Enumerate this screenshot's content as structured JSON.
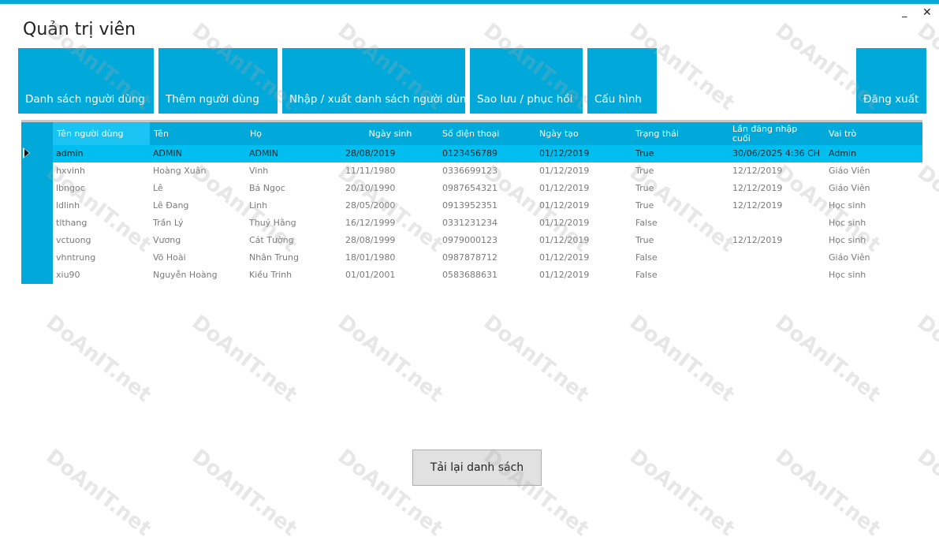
{
  "window": {
    "title": "Quản trị viên",
    "minimize_glyph": "_",
    "close_glyph": "✕"
  },
  "tiles": [
    {
      "label": "Danh sách người dùng"
    },
    {
      "label": "Thêm người dùng"
    },
    {
      "label": "Nhập / xuất danh sách người dùng"
    },
    {
      "label": "Sao lưu / phục hồi"
    },
    {
      "label": "Cấu hình"
    },
    {
      "label": "Đăng xuất"
    }
  ],
  "table": {
    "headers": [
      "Tên người dùng",
      "Tên",
      "Họ",
      "Ngày sinh",
      "Số điện thoại",
      "Ngày tạo",
      "Trạng thái",
      "Lần đăng nhập cuối",
      "Vai trò"
    ],
    "selected_row": 0,
    "rows": [
      [
        "admin",
        "ADMIN",
        "ADMIN",
        "28/08/2019",
        "0123456789",
        "01/12/2019",
        "True",
        "30/06/2025 4:36 CH",
        "Admin"
      ],
      [
        "hxvinh",
        "Hoàng Xuân",
        "Vinh",
        "11/11/1980",
        "0336699123",
        "01/12/2019",
        "True",
        "12/12/2019",
        "Giáo Viên"
      ],
      [
        "lbngoc",
        "Lê",
        "Bá Ngọc",
        "20/10/1990",
        "0987654321",
        "01/12/2019",
        "True",
        "12/12/2019",
        "Giáo Viên"
      ],
      [
        "ldlinh",
        "Lê Đang",
        "Linh",
        "28/05/2000",
        "0913952351",
        "01/12/2019",
        "True",
        "12/12/2019",
        "Học sinh"
      ],
      [
        "tlthang",
        "Trần Lý",
        "Thuý Hằng",
        "16/12/1999",
        "0331231234",
        "01/12/2019",
        "False",
        "",
        "Học sinh"
      ],
      [
        "vctuong",
        "Vương",
        "Cát Tường",
        "28/08/1999",
        "0979000123",
        "01/12/2019",
        "True",
        "12/12/2019",
        "Học sinh"
      ],
      [
        "vhntrung",
        "Võ Hoài",
        "Nhân Trung",
        "18/01/1980",
        "0987878712",
        "01/12/2019",
        "False",
        "",
        "Giáo Viên"
      ],
      [
        "xiu90",
        "Nguyễn Hoàng",
        "Kiều Trinh",
        "01/01/2001",
        "0583688631",
        "01/12/2019",
        "False",
        "",
        "Học sinh"
      ]
    ]
  },
  "reload_button": {
    "label": "Tải lại danh sách"
  },
  "watermark": {
    "text": "DoAnIT.net"
  },
  "colors": {
    "accent": "#00a9d9",
    "selected_row": "#00bff0",
    "top_bar": "#0aa8d8"
  }
}
